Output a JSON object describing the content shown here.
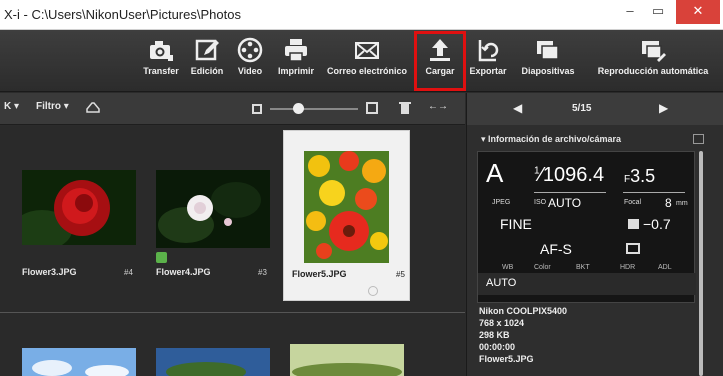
{
  "window": {
    "title": "X-i - C:\\Users\\NikonUser\\Pictures\\Photos",
    "minimize": "–",
    "maximize": "▭",
    "close": "✕"
  },
  "toolbar": {
    "transfer": "Transfer",
    "edicion": "Edición",
    "video": "Video",
    "imprimir": "Imprimir",
    "correo": "Correo electrónico",
    "cargar": "Cargar",
    "exportar": "Exportar",
    "diapositivas": "Diapositivas",
    "reproduccion": "Reproducción automática"
  },
  "browser_toolbar": {
    "sort_fragment": "K ▾",
    "filter": "Filtro ▾",
    "arrow_control": "←→"
  },
  "thumbnails": [
    {
      "name": "Flower3.JPG",
      "number": "#4"
    },
    {
      "name": "Flower4.JPG",
      "number": "#3"
    },
    {
      "name": "Flower5.JPG",
      "number": "#5"
    }
  ],
  "viewer": {
    "page": "5/15",
    "prev": "◀",
    "next": "▶"
  },
  "info_panel": {
    "section_title": "▾ Información de archivo/cámara",
    "mode": "A",
    "shutter_num": "1",
    "shutter": "⁄1096.4",
    "aperture_prefix": "F",
    "aperture": "3.5",
    "format": "JPEG",
    "iso_label": "ISO",
    "iso": "AUTO",
    "focal_label": "Focal",
    "focal": "8",
    "focal_unit": "mm",
    "quality": "FINE",
    "exposure_comp": "−0.7",
    "af_mode": "AF-S",
    "col_wb": "WB",
    "col_color": "Color",
    "col_bkt": "BKT",
    "col_hdr": "HDR",
    "col_adl": "ADL",
    "wb_value": "AUTO"
  },
  "file_details": {
    "camera": "Nikon COOLPIX5400",
    "dimensions": "768 x 1024",
    "size": "298 KB",
    "time": "00:00:00",
    "filename": "Flower5.JPG"
  }
}
